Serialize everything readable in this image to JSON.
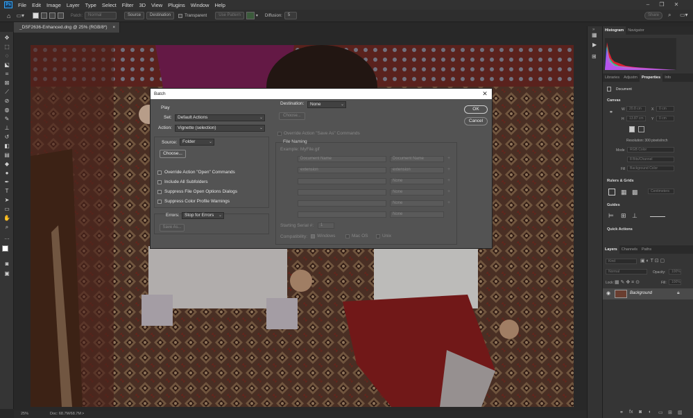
{
  "menubar": {
    "items": [
      "File",
      "Edit",
      "Image",
      "Layer",
      "Type",
      "Select",
      "Filter",
      "3D",
      "View",
      "Plugins",
      "Window",
      "Help"
    ]
  },
  "options_bar": {
    "patch_label": "Patch:",
    "patch_mode": "Normal",
    "source_label": "Source",
    "destination_label": "Destination",
    "transparent_label": "Transparent",
    "use_pattern_label": "Use Pattern",
    "diffusion_label": "Diffusion:",
    "diffusion_value": "5",
    "share_label": "Share"
  },
  "document_tab": {
    "title": "_DSF2636-Enhanced.dng @ 25% (RGB/8*)",
    "close": "×"
  },
  "status_bar": {
    "zoom": "25%",
    "doc": "Doc: 68.7M/68.7M",
    "arrow": ">"
  },
  "dialog": {
    "title": "Batch",
    "close": "✕",
    "play": {
      "heading": "Play",
      "set_label": "Set:",
      "set_value": "Default Actions",
      "action_label": "Action:",
      "action_value": "Vignette (selection)"
    },
    "source": {
      "label": "Source:",
      "value": "Folder",
      "choose": "Choose...",
      "checkboxes": [
        "Override Action \"Open\" Commands",
        "Include All Subfolders",
        "Suppress File Open Options Dialogs",
        "Suppress Color Profile Warnings"
      ]
    },
    "errors": {
      "label": "Errors:",
      "value": "Stop for Errors",
      "save_as": "Save As..."
    },
    "destination": {
      "label": "Destination:",
      "value": "None",
      "choose": "Choose...",
      "override_label": "Override Action \"Save As\" Commands",
      "file_naming": "File Naming",
      "example": "Example: MyFile.gif",
      "naming_rows": [
        {
          "left": "Document Name",
          "right": "Document Name"
        },
        {
          "left": "extension",
          "right": "extension"
        },
        {
          "left": "",
          "right": "None"
        },
        {
          "left": "",
          "right": "None"
        },
        {
          "left": "",
          "right": "None"
        },
        {
          "left": "",
          "right": "None"
        }
      ],
      "plus": "+",
      "starting_serial_label": "Starting Serial #:",
      "starting_serial_value": "1",
      "compatibility_label": "Compatibility:",
      "compat_windows": "Windows",
      "compat_macos": "Mac OS",
      "compat_unix": "Unix"
    },
    "ok": "OK",
    "cancel": "Cancel"
  },
  "histogram_panel": {
    "tabs": [
      "Histogram",
      "Navigator"
    ]
  },
  "properties_panel": {
    "tabs": [
      "Libraries",
      "Adjustm",
      "Properties",
      "Info"
    ],
    "doc_label": "Document",
    "canvas_heading": "Canvas",
    "w_label": "W",
    "w_value": "20.8 cm",
    "h_label": "H",
    "h_value": "13.87 cm",
    "x_label": "X",
    "x_value": "0 cm",
    "y_label": "Y",
    "y_value": "0 cm",
    "resolution": "Resolution: 300 pixels/inch",
    "mode_label": "Mode",
    "mode_value": "RGB Color",
    "depth_value": "8 Bits/Channel",
    "fill_label": "Fill",
    "fill_value": "Background Color",
    "rulers_heading": "Rulers & Grids",
    "centimeters": "Centimeters",
    "guides_heading": "Guides",
    "quick_actions_heading": "Quick Actions"
  },
  "layers_panel": {
    "tabs": [
      "Layers",
      "Channels",
      "Paths"
    ],
    "kind_placeholder": "Kind",
    "blend_mode": "Normal",
    "opacity_label": "Opacity:",
    "opacity_value": "100%",
    "lock_label": "Lock:",
    "fill_label": "Fill:",
    "fill_value": "100%",
    "layer_name": "Background",
    "footer_icons": [
      "link-icon",
      "fx-icon",
      "mask-icon",
      "adjustment-icon",
      "group-icon",
      "new-layer-icon",
      "trash-icon"
    ]
  },
  "colors": {
    "accent": "#31a8ff",
    "dialog_bg": "#535353",
    "panel_bg": "#353535"
  }
}
